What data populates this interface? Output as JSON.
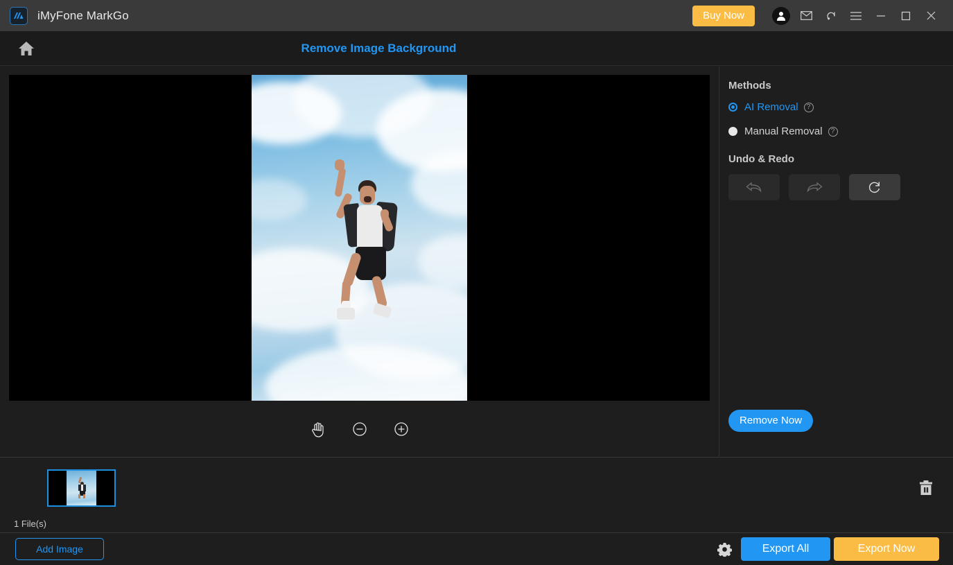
{
  "titlebar": {
    "app_name": "iMyFone MarkGo",
    "logo_icon": "markgo-logo-icon",
    "buy_now": "Buy Now",
    "icons": [
      {
        "name": "account-icon",
        "glyph": "person"
      },
      {
        "name": "mail-icon",
        "glyph": "envelope"
      },
      {
        "name": "support-icon",
        "glyph": "headset"
      },
      {
        "name": "menu-icon",
        "glyph": "hamburger"
      },
      {
        "name": "minimize-icon",
        "glyph": "minus"
      },
      {
        "name": "maximize-icon",
        "glyph": "square"
      },
      {
        "name": "close-icon",
        "glyph": "cross"
      }
    ],
    "accent_buy": "#fbbc45",
    "bg": "#3a3a3a"
  },
  "header": {
    "home_icon": "home-icon",
    "title": "Remove Image Background",
    "title_color": "#2196f3"
  },
  "canvas": {
    "background": "#000000",
    "image_alt": "man jumping in air against blue cloudy sky",
    "tools": [
      {
        "name": "pan-hand-tool",
        "label": "hand"
      },
      {
        "name": "zoom-out-tool",
        "label": "minus"
      },
      {
        "name": "zoom-in-tool",
        "label": "plus"
      }
    ]
  },
  "right_panel": {
    "methods_title": "Methods",
    "methods": [
      {
        "label": "AI Removal",
        "selected": true,
        "help": "?"
      },
      {
        "label": "Manual Removal",
        "selected": false,
        "help": "?"
      }
    ],
    "undo_redo_title": "Undo & Redo",
    "undo_redo_buttons": [
      {
        "name": "undo-button",
        "enabled": false
      },
      {
        "name": "redo-button",
        "enabled": false
      },
      {
        "name": "reset-button",
        "enabled": true
      }
    ],
    "remove_now": "Remove Now",
    "remove_now_color": "#2196f3"
  },
  "strip": {
    "file_count": "1 File(s)",
    "thumbnail_selected": true,
    "thumbnail_border_color": "#1f8fe0",
    "delete_icon": "trash-icon"
  },
  "bottombar": {
    "add_image": "Add Image",
    "settings_icon": "gear-icon",
    "export_all": "Export All",
    "export_now": "Export Now",
    "export_all_color": "#2196f3",
    "export_now_color": "#fbbc45"
  }
}
